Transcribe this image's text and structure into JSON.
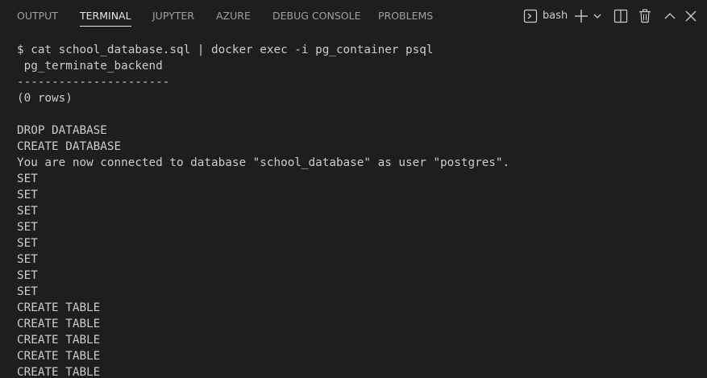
{
  "tabs": [
    {
      "label": "OUTPUT"
    },
    {
      "label": "TERMINAL"
    },
    {
      "label": "JUPYTER"
    },
    {
      "label": "AZURE"
    },
    {
      "label": "DEBUG CONSOLE"
    },
    {
      "label": "PROBLEMS"
    }
  ],
  "active_tab": "TERMINAL",
  "toolbar": {
    "shell_icon": "terminal-shell-icon",
    "shell_name": "bash",
    "new_terminal_icon": "plus-icon",
    "dropdown_icon": "chevron-down-icon",
    "split_icon": "split-terminal-icon",
    "kill_icon": "trash-icon",
    "maximize_icon": "chevron-up-icon",
    "close_icon": "close-icon"
  },
  "terminal": {
    "lines": [
      "$ cat school_database.sql | docker exec -i pg_container psql",
      " pg_terminate_backend",
      "----------------------",
      "(0 rows)",
      "",
      "DROP DATABASE",
      "CREATE DATABASE",
      "You are now connected to database \"school_database\" as user \"postgres\".",
      "SET",
      "SET",
      "SET",
      "SET",
      "SET",
      "SET",
      "SET",
      "SET",
      "CREATE TABLE",
      "CREATE TABLE",
      "CREATE TABLE",
      "CREATE TABLE",
      "CREATE TABLE"
    ]
  },
  "colors": {
    "background": "#1e1e1e",
    "text": "#cccccc",
    "tab_inactive": "#a0a0a0",
    "tab_active": "#e7e7e7"
  }
}
